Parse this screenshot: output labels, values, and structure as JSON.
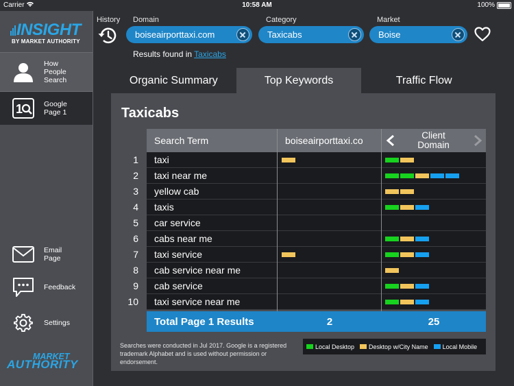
{
  "status": {
    "carrier": "Carrier",
    "time": "10:58 AM",
    "battery": "100%"
  },
  "brand": {
    "title": "INSIGHT",
    "subtitle": "BY MARKET AUTHORITY"
  },
  "sidebar": {
    "items": [
      {
        "label_line1": "How",
        "label_line2": "People",
        "label_line3": "Search"
      },
      {
        "label_line1": "Google",
        "label_line2": "Page 1"
      },
      {
        "label_line1": "Email",
        "label_line2": "Page"
      },
      {
        "label_line1": "Feedback"
      },
      {
        "label_line1": "Settings"
      }
    ],
    "footer_logo": {
      "line1": "MARKET",
      "line2": "AUTHORITY"
    }
  },
  "filters": {
    "history_label": "History",
    "domain_label": "Domain",
    "domain_value": "boiseairporttaxi.com",
    "category_label": "Category",
    "category_value": "Taxicabs",
    "market_label": "Market",
    "market_value": "Boise",
    "results_prefix": "Results found in ",
    "results_link": "Taxicabs"
  },
  "tabs": [
    {
      "label": "Organic Summary",
      "active": false
    },
    {
      "label": "Top Keywords",
      "active": true
    },
    {
      "label": "Traffic Flow",
      "active": false
    }
  ],
  "panel": {
    "title": "Taxicabs",
    "col_term": "Search Term",
    "col_domain": "boiseairporttaxi.co",
    "col_client_line1": "Client",
    "col_client_line2": "Domain",
    "rows": [
      {
        "rank": "1",
        "term": "taxi",
        "domain": [
          "y"
        ],
        "client": [
          "g",
          "y"
        ]
      },
      {
        "rank": "2",
        "term": "taxi near me",
        "domain": [],
        "client": [
          "g",
          "g",
          "y",
          "b",
          "b"
        ]
      },
      {
        "rank": "3",
        "term": "yellow cab",
        "domain": [],
        "client": [
          "y",
          "y"
        ]
      },
      {
        "rank": "4",
        "term": "taxis",
        "domain": [],
        "client": [
          "g",
          "y",
          "b"
        ]
      },
      {
        "rank": "5",
        "term": "car service",
        "domain": [],
        "client": []
      },
      {
        "rank": "6",
        "term": "cabs near me",
        "domain": [],
        "client": [
          "g",
          "y",
          "b"
        ]
      },
      {
        "rank": "7",
        "term": "taxi service",
        "domain": [
          "y"
        ],
        "client": [
          "g",
          "y",
          "b"
        ]
      },
      {
        "rank": "8",
        "term": "cab service near me",
        "domain": [],
        "client": [
          "y"
        ]
      },
      {
        "rank": "9",
        "term": "cab service",
        "domain": [],
        "client": [
          "g",
          "y",
          "b"
        ]
      },
      {
        "rank": "10",
        "term": "taxi service near me",
        "domain": [],
        "client": [
          "g",
          "y",
          "b"
        ]
      }
    ],
    "total_label": "Total Page 1 Results",
    "total_domain": "2",
    "total_client": "25",
    "disclaimer": "Searches were conducted in Jul 2017. Google is a registered trademark Alphabet and is used without permission or endorsement.",
    "legend": [
      {
        "label": "Local Desktop",
        "color": "#17d21e"
      },
      {
        "label": "Desktop w/City Name",
        "color": "#f2c55c"
      },
      {
        "label": "Local Mobile",
        "color": "#16a0f0"
      }
    ]
  },
  "icons": {
    "history": "history-icon",
    "heart": "heart-icon",
    "person": "person-icon",
    "google_page": "google-page-icon",
    "email": "envelope-icon",
    "feedback": "speech-bubble-icon",
    "settings": "gear-icon",
    "arrow_left": "chevron-left-icon",
    "arrow_right": "chevron-right-icon"
  }
}
